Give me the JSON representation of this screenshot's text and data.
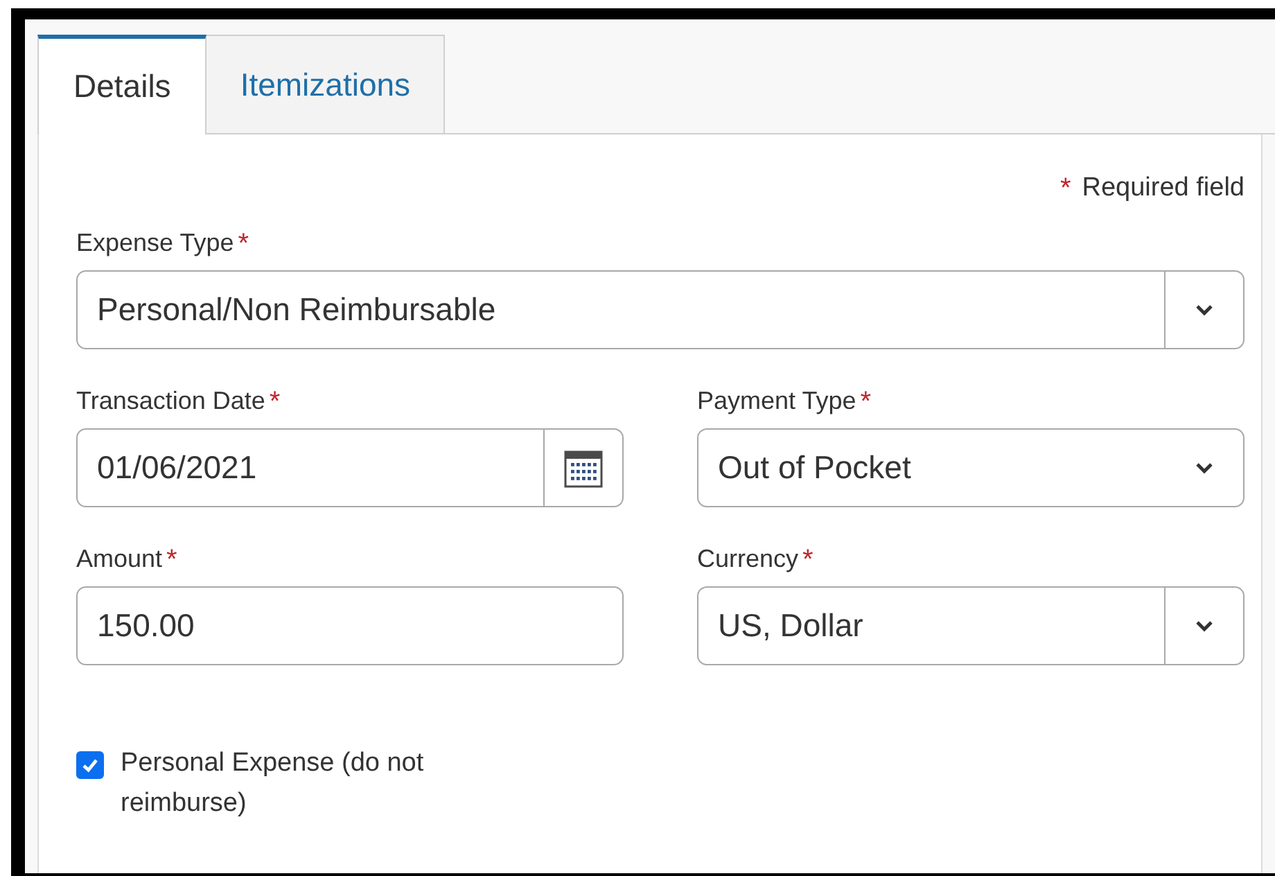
{
  "tabs": [
    {
      "label": "Details",
      "selected": true
    },
    {
      "label": "Itemizations",
      "selected": false
    }
  ],
  "required_note": {
    "mark": "*",
    "text": "Required field"
  },
  "rows": [
    [
      {
        "kind": "select",
        "label": "Expense Type",
        "mark": "*",
        "value": "Personal/Non Reimbursable",
        "divider": true
      }
    ],
    [
      {
        "kind": "date",
        "label": "Transaction Date",
        "mark": "*",
        "value": "01/06/2021"
      },
      {
        "kind": "select",
        "label": "Payment Type",
        "mark": "*",
        "value": "Out of Pocket",
        "divider": false
      }
    ],
    [
      {
        "kind": "text",
        "label": "Amount",
        "mark": "*",
        "value": "150.00"
      },
      {
        "kind": "select",
        "label": "Currency",
        "mark": "*",
        "value": "US, Dollar",
        "divider": true
      }
    ]
  ],
  "checkbox": {
    "label": "Personal Expense (do not reimburse)",
    "checked": true
  }
}
